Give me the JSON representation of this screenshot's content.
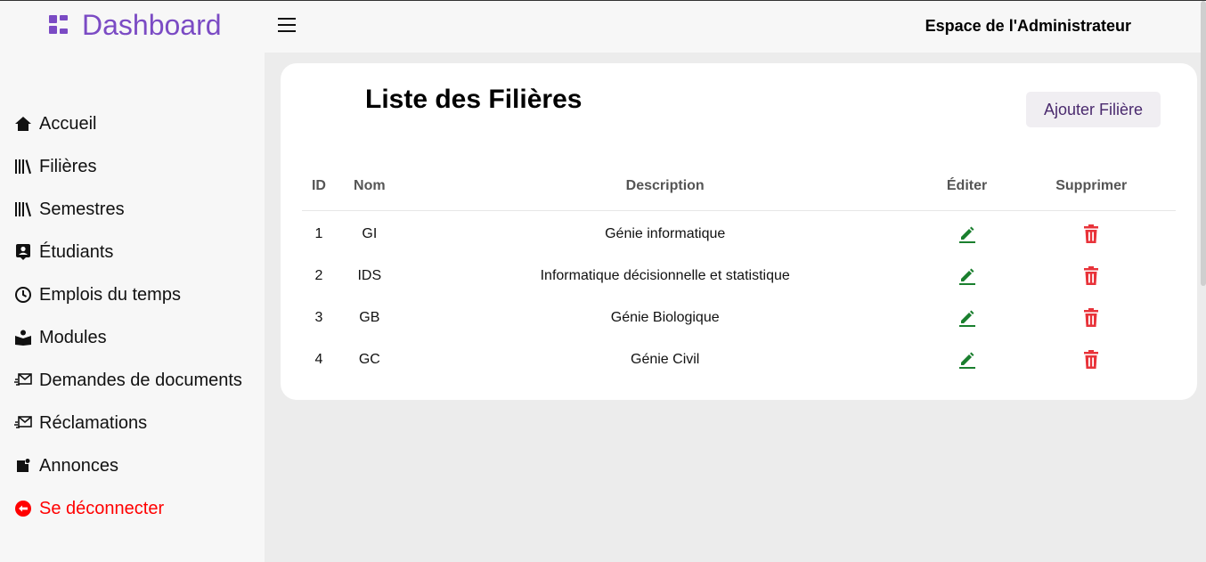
{
  "brand": {
    "title": "Dashboard",
    "icon": "dashboard-grid-icon",
    "color": "#7b4bc4"
  },
  "sidebar": {
    "items": [
      {
        "label": "Accueil",
        "icon": "home-icon"
      },
      {
        "label": "Filières",
        "icon": "library-icon"
      },
      {
        "label": "Semestres",
        "icon": "library-icon"
      },
      {
        "label": "Étudiants",
        "icon": "student-badge-icon"
      },
      {
        "label": "Emplois du temps",
        "icon": "clock-icon"
      },
      {
        "label": "Modules",
        "icon": "book-reader-icon"
      },
      {
        "label": "Demandes de documents",
        "icon": "mail-send-icon"
      },
      {
        "label": "Réclamations",
        "icon": "mail-send-icon"
      },
      {
        "label": "Annonces",
        "icon": "announcement-icon"
      },
      {
        "label": "Se déconnecter",
        "icon": "logout-icon",
        "color": "#ff0000"
      }
    ]
  },
  "header": {
    "title": "Espace de l'Administrateur",
    "menu_icon": "hamburger-menu-icon"
  },
  "main": {
    "title": "Liste des Filières",
    "add_button": "Ajouter Filière",
    "table": {
      "columns": [
        "ID",
        "Nom",
        "Description",
        "Éditer",
        "Supprimer"
      ],
      "rows": [
        {
          "id": "1",
          "nom": "GI",
          "description": "Génie informatique"
        },
        {
          "id": "2",
          "nom": "IDS",
          "description": "Informatique décisionnelle et statistique"
        },
        {
          "id": "3",
          "nom": "GB",
          "description": "Génie Biologique"
        },
        {
          "id": "4",
          "nom": "GC",
          "description": "Génie Civil"
        }
      ],
      "edit_icon": "pencil-icon",
      "delete_icon": "trash-icon",
      "edit_color": "#1a7f2e",
      "delete_color": "#e8333a"
    }
  }
}
